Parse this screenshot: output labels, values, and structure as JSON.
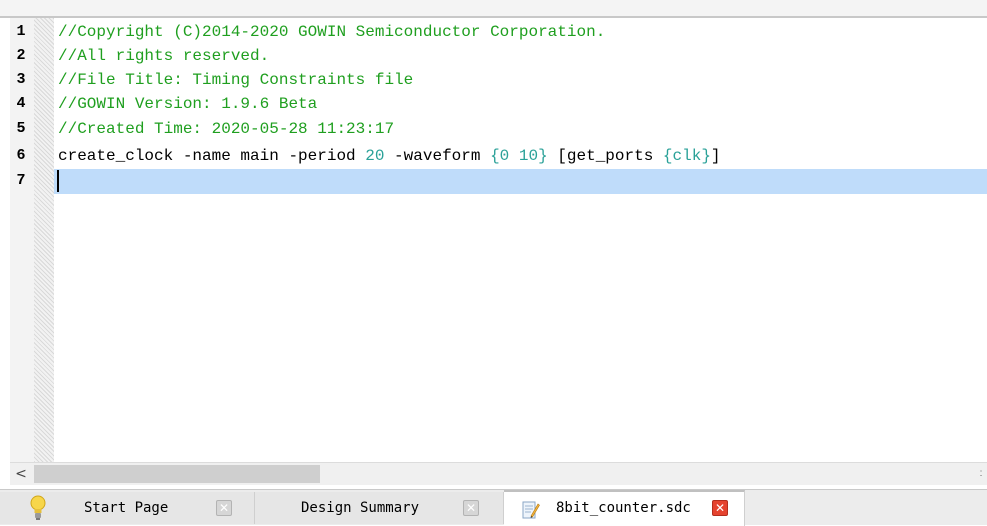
{
  "editor": {
    "lines": [
      {
        "number": "1",
        "text": "//Copyright (C)2014-2020 GOWIN Semiconductor Corporation."
      },
      {
        "number": "2",
        "text": "//All rights reserved."
      },
      {
        "number": "3",
        "text": "//File Title: Timing Constraints file"
      },
      {
        "number": "4",
        "text": "//GOWIN Version: 1.9.6 Beta"
      },
      {
        "number": "5",
        "text": "//Created Time: 2020-05-28 11:23:17"
      },
      {
        "number": "6",
        "tokens": {
          "cmd": "create_clock -name main -period ",
          "period": "20",
          "waveform_flag": " -waveform ",
          "waveform": "{0 10}",
          "get_ports_open": " [get_ports ",
          "port": "{clk}",
          "close": "]"
        }
      },
      {
        "number": "7",
        "text": ""
      }
    ]
  },
  "scrollbar": {
    "left_arrow": "<",
    "right_arrow": ":"
  },
  "tabs": [
    {
      "label": "Start Page",
      "icon": "lightbulb-icon",
      "close": "✕"
    },
    {
      "label": "Design Summary",
      "close": "✕"
    },
    {
      "label": "8bit_counter.sdc",
      "icon": "document-edit-icon",
      "close": "✕",
      "active": true
    }
  ],
  "colors": {
    "comment": "#1f9f1f",
    "number": "#2aa198",
    "current_line": "#bfdcfa",
    "close_active": "#e5432f"
  }
}
